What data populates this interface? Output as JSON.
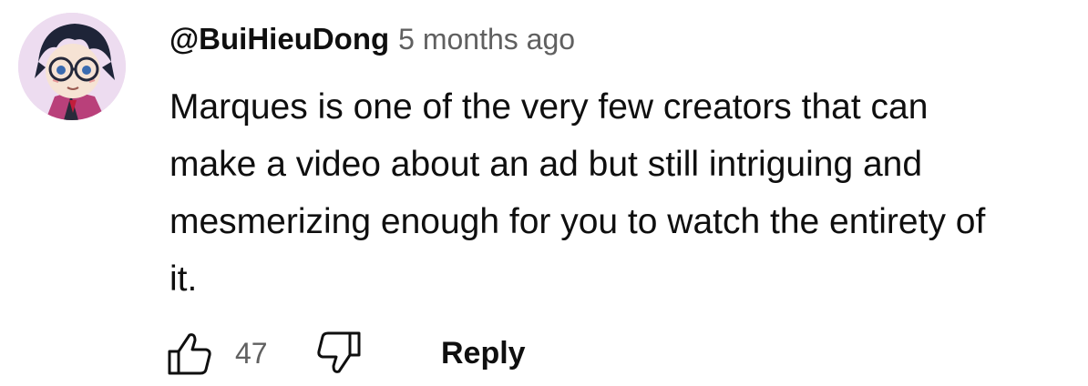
{
  "comment": {
    "author": "@BuiHieuDong",
    "timestamp": "5 months ago",
    "text_lines": [
      "Marques is one of the very few creators that can",
      "make a video about an ad but still intriguing and",
      "mesmerizing enough for you to watch the entirety of",
      "it."
    ]
  },
  "actions": {
    "like_icon": "thumb-up-icon",
    "like_count": "47",
    "dislike_icon": "thumb-down-icon",
    "reply_label": "Reply"
  },
  "colors": {
    "text_primary": "#0f0f0f",
    "text_secondary": "#606060",
    "background": "#ffffff"
  }
}
